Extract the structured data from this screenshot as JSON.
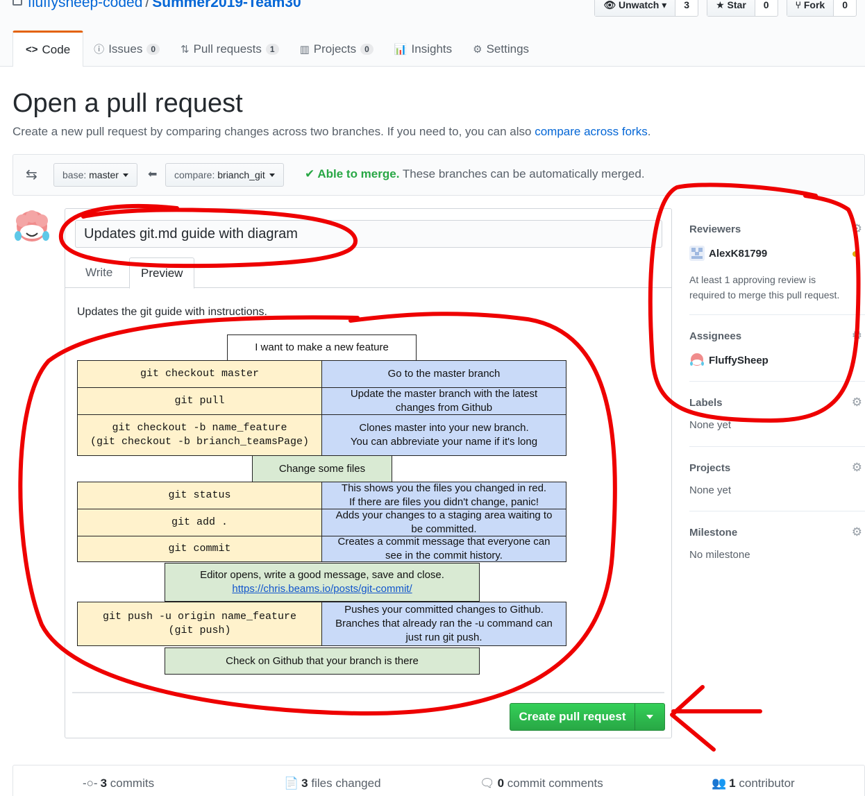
{
  "repo": {
    "owner": "fluffysheep-coded",
    "separator": "/",
    "name": "Summer2019-Team30"
  },
  "actions": [
    {
      "label": "Unwatch",
      "icon": "eye-icon",
      "count": "3"
    },
    {
      "label": "Star",
      "icon": "star-icon",
      "count": "0"
    },
    {
      "label": "Fork",
      "icon": "fork-icon",
      "count": "0"
    }
  ],
  "nav": {
    "code": "Code",
    "issues": {
      "label": "Issues",
      "count": "0"
    },
    "pulls": {
      "label": "Pull requests",
      "count": "1"
    },
    "projects": {
      "label": "Projects",
      "count": "0"
    },
    "insights": "Insights",
    "settings": "Settings"
  },
  "page": {
    "title": "Open a pull request",
    "subtitle": "Create a new pull request by comparing changes across two branches. If you need to, you can also ",
    "subtitle_link": "compare across forks",
    "subtitle_end": "."
  },
  "range": {
    "base_prefix": "base: ",
    "base": "master",
    "compare_prefix": "compare: ",
    "compare": "brianch_git",
    "merge_ok": "Able to merge.",
    "merge_text": " These branches can be automatically merged."
  },
  "compose": {
    "title_value": "Updates git.md guide with diagram",
    "tab_write": "Write",
    "tab_preview": "Preview",
    "preview_text": "Updates the git guide with instructions.",
    "create_button": "Create pull request"
  },
  "diagram": {
    "start": "I want to make a new feature",
    "rows": [
      {
        "code": "git checkout master",
        "desc": "Go to the master branch"
      },
      {
        "code": "git pull",
        "desc": "Update the master branch with the latest changes from Github"
      },
      {
        "code": "git checkout -b name_feature\n(git checkout -b brianch_teamsPage)",
        "desc": "Clones master into your new branch.\nYou can abbreviate your name if it's long"
      }
    ],
    "step_change": "Change some files",
    "rows2": [
      {
        "code": "git status",
        "desc": "This shows you the files you changed in red.\nIf there are files you didn't change, panic!"
      },
      {
        "code": "git add .",
        "desc": "Adds your changes to a staging area waiting to be committed."
      },
      {
        "code": "git commit",
        "desc": "Creates a commit message that everyone can see in the commit history."
      }
    ],
    "editor_text": "Editor opens, write a good message, save and close.",
    "editor_link": "https://chris.beams.io/posts/git-commit/",
    "push_code": "git push -u origin name_feature\n(git push)",
    "push_desc": "Pushes your committed changes to Github. Branches that already ran the -u command can just run git push.",
    "check": "Check on Github that your branch is there"
  },
  "sidebar": {
    "reviewers": {
      "label": "Reviewers",
      "user": "AlexK81799",
      "note_1": "At least 1 approving review is",
      "note_2": "required to merge this pull request."
    },
    "assignees": {
      "label": "Assignees",
      "user": "FluffySheep"
    },
    "labels": {
      "label": "Labels",
      "value": "None yet"
    },
    "projects": {
      "label": "Projects",
      "value": "None yet"
    },
    "milestone": {
      "label": "Milestone",
      "value": "No milestone"
    }
  },
  "summary": {
    "commits_n": "3",
    "commits": " commits",
    "files_n": "3",
    "files": " files changed",
    "comments_n": "0",
    "comments": " commit comments",
    "contrib_n": "1",
    "contrib": " contributor"
  },
  "colors": {
    "accent": "#0366d6",
    "green": "#28a745",
    "annotation": "#ee0000",
    "tab_highlight": "#e36209"
  }
}
